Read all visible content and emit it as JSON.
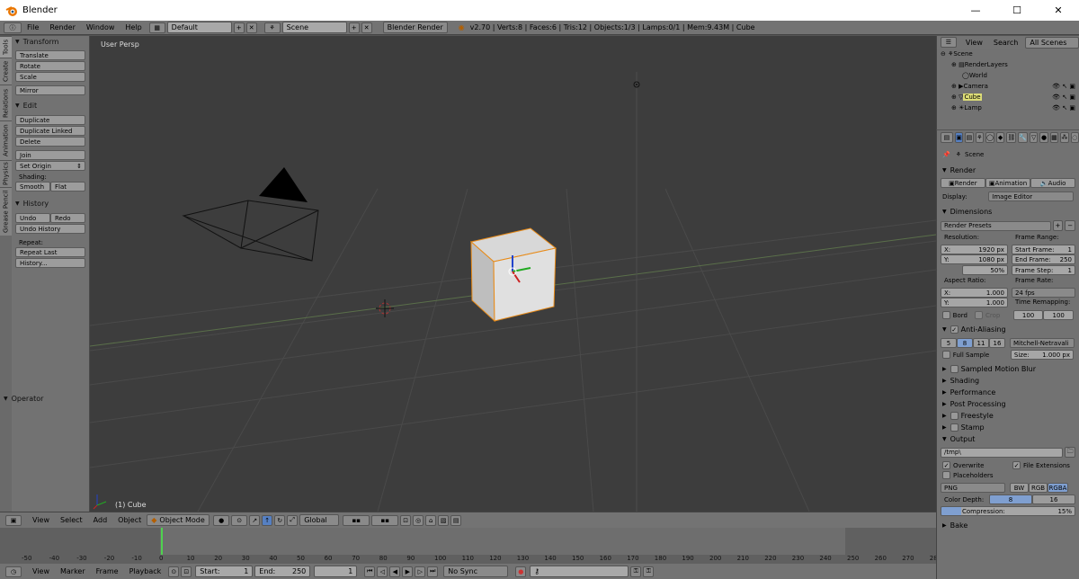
{
  "window": {
    "title": "Blender",
    "minimize": "—",
    "maximize": "☐",
    "close": "✕"
  },
  "info": {
    "menus": [
      "File",
      "Render",
      "Window",
      "Help"
    ],
    "layout": "Default",
    "scene": "Scene",
    "engine": "Blender Render",
    "stats": "v2.70 | Verts:8 | Faces:6 | Tris:12 | Objects:1/3 | Lamps:0/1 | Mem:9.43M | Cube"
  },
  "tabs": [
    "Tools",
    "Create",
    "Relations",
    "Animation",
    "Physics",
    "Grease Pencil"
  ],
  "toolshelf": {
    "transform_title": "Transform",
    "translate": "Translate",
    "rotate": "Rotate",
    "scale": "Scale",
    "mirror": "Mirror",
    "edit_title": "Edit",
    "duplicate": "Duplicate",
    "duplicate_linked": "Duplicate Linked",
    "delete": "Delete",
    "join": "Join",
    "set_origin": "Set Origin",
    "shading_label": "Shading:",
    "smooth": "Smooth",
    "flat": "Flat",
    "history_title": "History",
    "undo": "Undo",
    "redo": "Redo",
    "undo_history": "Undo History",
    "repeat_label": "Repeat:",
    "repeat_last": "Repeat Last",
    "history_btn": "History...",
    "operator_title": "Operator"
  },
  "viewport": {
    "view_label": "User Persp",
    "object_label": "(1) Cube"
  },
  "vp_header": {
    "menus": [
      "View",
      "Select",
      "Add",
      "Object"
    ],
    "mode": "Object Mode",
    "orientation": "Global"
  },
  "timeline": {
    "ticks": [
      "-50",
      "-40",
      "-30",
      "-20",
      "-10",
      "0",
      "10",
      "20",
      "30",
      "40",
      "50",
      "60",
      "70",
      "80",
      "90",
      "100",
      "110",
      "120",
      "130",
      "140",
      "150",
      "160",
      "170",
      "180",
      "190",
      "200",
      "210",
      "220",
      "230",
      "240",
      "250",
      "260",
      "270",
      "280"
    ]
  },
  "tl_header": {
    "menus": [
      "View",
      "Marker",
      "Frame",
      "Playback"
    ],
    "start": "Start:",
    "start_val": "1",
    "end": "End:",
    "end_val": "250",
    "current": "1",
    "sync": "No Sync"
  },
  "outliner": {
    "view": "View",
    "search": "Search",
    "all_scenes": "All Scenes",
    "items": [
      "Scene",
      "RenderLayers",
      "World",
      "Camera",
      "Cube",
      "Lamp"
    ]
  },
  "props": {
    "scene": "Scene",
    "render_title": "Render",
    "render_btn": "Render",
    "animation_btn": "Animation",
    "audio_btn": "Audio",
    "display_label": "Display:",
    "display_val": "Image Editor",
    "dimensions_title": "Dimensions",
    "render_presets": "Render Presets",
    "resolution": "Resolution:",
    "res_x": "X:",
    "res_x_val": "1920 px",
    "res_y": "Y:",
    "res_y_val": "1080 px",
    "res_pct": "50%",
    "frame_range": "Frame Range:",
    "start_frame": "Start Frame:",
    "start_frame_val": "1",
    "end_frame": "End Frame:",
    "end_frame_val": "250",
    "frame_step": "Frame Step:",
    "frame_step_val": "1",
    "aspect": "Aspect Ratio:",
    "asp_x": "X:",
    "asp_x_val": "1.000",
    "asp_y": "Y:",
    "asp_y_val": "1.000",
    "frame_rate": "Frame Rate:",
    "fps": "24 fps",
    "time_remap": "Time Remapping:",
    "remap_old": "100",
    "remap_new": "100",
    "bord": "Bord",
    "crop": "Crop",
    "aa_title": "Anti-Aliasing",
    "aa_vals": [
      "5",
      "8",
      "11",
      "16"
    ],
    "filter": "Mitchell-Netravali",
    "full_sample": "Full Sample",
    "size_label": "Size:",
    "size_val": "1.000 px",
    "motion_blur": "Sampled Motion Blur",
    "shading": "Shading",
    "performance": "Performance",
    "post_processing": "Post Processing",
    "freestyle": "Freestyle",
    "stamp": "Stamp",
    "output_title": "Output",
    "output_path": "/tmp\\",
    "overwrite": "Overwrite",
    "file_extensions": "File Extensions",
    "placeholders": "Placeholders",
    "format": "PNG",
    "bw": "BW",
    "rgb": "RGB",
    "rgba": "RGBA",
    "color_depth": "Color Depth:",
    "depth_8": "8",
    "depth_16": "16",
    "compression": "Compression:",
    "compression_val": "15%",
    "bake": "Bake"
  }
}
